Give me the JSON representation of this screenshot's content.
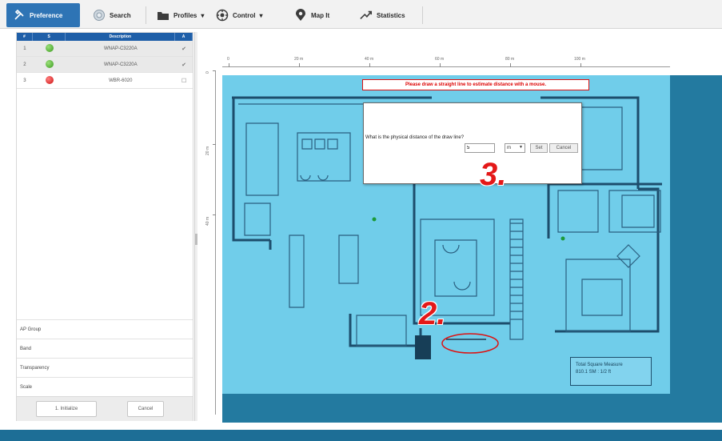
{
  "toolbar": {
    "tabs": [
      {
        "label": "Preference",
        "icon": "preference-icon"
      },
      {
        "label": "Search",
        "icon": "search-icon"
      },
      {
        "label": "Profiles",
        "icon": "folder-icon"
      },
      {
        "label": "Control",
        "icon": "control-icon"
      },
      {
        "label": "Map It",
        "icon": "map-pin-icon"
      },
      {
        "label": "Statistics",
        "icon": "chart-icon"
      }
    ],
    "active_tab": "Preference",
    "accent_color": "#2e74b5"
  },
  "device_table": {
    "headers": [
      "#",
      "S",
      "Description",
      "A"
    ],
    "rows": [
      {
        "index": "1",
        "status": "green",
        "description": "WNAP-C3220A",
        "a": "✔"
      },
      {
        "index": "2",
        "status": "green",
        "description": "WNAP-C3220A",
        "a": "✔"
      },
      {
        "index": "3",
        "status": "red",
        "description": "WBR-6020",
        "a": "☐"
      }
    ]
  },
  "properties": [
    "AP Group",
    "Band",
    "Transparency",
    "Scale"
  ],
  "buttons": {
    "primary": "1. Initialize",
    "cancel": "Cancel"
  },
  "ruler": {
    "top_labels": [
      "0",
      "20 m",
      "40 m",
      "60 m",
      "80 m",
      "100 m"
    ],
    "left_labels": [
      "0",
      "20 m",
      "40 m"
    ]
  },
  "map": {
    "instruction": "Please draw a straight line to estimate distance with a mouse.",
    "background_color": "#70cdea",
    "totals_title": "Total Square Measure",
    "totals_value": "810.1 SM : 1/2 ft"
  },
  "dialog": {
    "question": "What is the physical distance of the draw line?",
    "input_value": "5",
    "unit": "m",
    "set_label": "Set",
    "cancel_label": "Cancel"
  },
  "annotations": {
    "step_2": "2.",
    "step_3": "3."
  }
}
